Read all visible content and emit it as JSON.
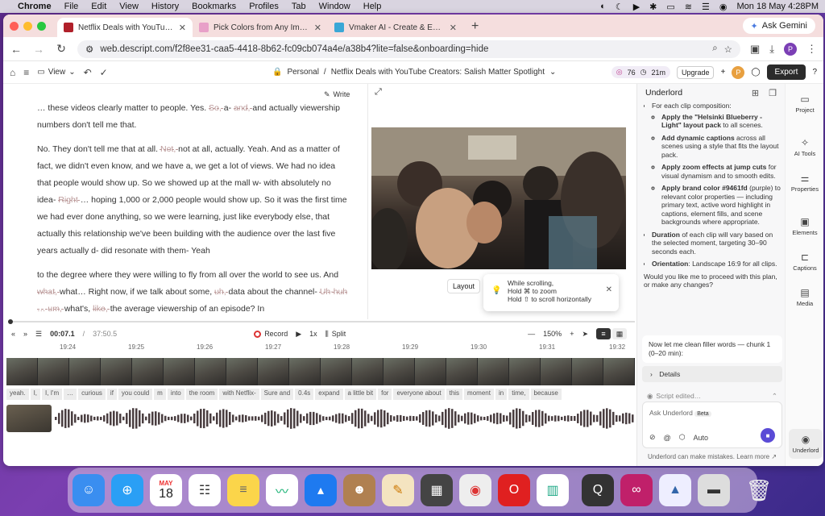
{
  "menubar": {
    "app": "Chrome",
    "items": [
      "File",
      "Edit",
      "View",
      "History",
      "Bookmarks",
      "Profiles",
      "Tab",
      "Window",
      "Help"
    ],
    "clock": "Mon 18 May  4:28PM"
  },
  "tabs": [
    {
      "label": "Netflix Deals with YouTube Cr…",
      "color": "#b0202a"
    },
    {
      "label": "Pick Colors from Any Image -…",
      "color": "#e8a0c8"
    },
    {
      "label": "Vmaker AI - Create & Edit Vid…",
      "color": "#3aa7d6"
    }
  ],
  "ask_gemini": "Ask Gemini",
  "omnibox": {
    "url": "web.descript.com/f2f8ee31-caa5-4418-8b62-fc09cb074a4e/a38b4?lite=false&onboarding=hide"
  },
  "profile_initial": "P",
  "appbar": {
    "view_label": "View",
    "breadcrumb_workspace": "Personal",
    "breadcrumb_sep": "/",
    "project_title": "Netflix Deals with YouTube Creators: Salish Matter Spotlight",
    "credits": "76",
    "minutes": "21m",
    "upgrade": "Upgrade",
    "export": "Export"
  },
  "script": {
    "write_label": "Write",
    "p1": {
      "pre": "… these videos clearly matter to people. Yes. ",
      "s1": "So, ",
      "mid": "a- ",
      "s2": "and, ",
      "post": "and actually viewership numbers don't tell me that."
    },
    "p2": {
      "a": "No. They don't tell me that at all. ",
      "s1": "Not, ",
      "b": "not at all, actually. Yeah. And as a matter of fact, we didn't even know, and we have a, we get a lot of views. We had no idea that people would show up. So we showed up at the mall w- with absolutely no idea- ",
      "s2": "Right ",
      "c": "… hoping 1,000 or 2,000 people would show up. So it was the first time we had ever done anything, so we were learning, just like everybody else, that actually this relationship we've been building with the audience over the last five years actually d- did resonate with them- Yeah"
    },
    "p3": {
      "a": "to the degree where they were willing to fly from all over the world to see us. And ",
      "s1": "what, ",
      "b": "what… Right now, if we talk about some, ",
      "s2": "uh, ",
      "c": "data about the channel- ",
      "s3": "Uh-huh … um, ",
      "d": "what's, ",
      "s4": "like, ",
      "e": "the average viewership of an episode? In"
    }
  },
  "video": {
    "layout_label": "Layout",
    "tooltip_line1": "While scrolling,",
    "tooltip_line2": "Hold ⌘ to zoom",
    "tooltip_line3": "Hold ⇧ to scroll horizontally"
  },
  "transport": {
    "current": "00:07.1",
    "separator": "/",
    "total": "37:50.5",
    "record": "Record",
    "speed": "1x",
    "split": "Split",
    "zoom": "150%"
  },
  "ruler": [
    "19:24",
    "19:25",
    "19:26",
    "19:27",
    "19:28",
    "19:29",
    "19:30",
    "19:31",
    "19:32"
  ],
  "word_chips": [
    "yeah.",
    "I,",
    "I, I'm",
    "…",
    "curious",
    "if",
    "you could",
    "m",
    "into",
    "the room",
    "with Netflix-",
    "Sure and",
    "0.4s",
    "expand",
    "a little bit",
    "for",
    "everyone about",
    "this",
    "moment",
    "in",
    "time,",
    "because"
  ],
  "underlord": {
    "title": "Underlord",
    "intro": "For each clip composition:",
    "bullets": [
      {
        "bold": "Apply the \"Helsinki Blueberry - Light\" layout pack",
        "rest": " to all scenes."
      },
      {
        "bold": "Add dynamic captions",
        "rest": " across all scenes using a style that fits the layout pack."
      },
      {
        "bold": "Apply zoom effects at jump cuts",
        "rest": " for visual dynamism and to smooth edits."
      },
      {
        "bold": "Apply brand color #9461fd",
        "rest": " (purple) to relevant color properties — including primary text, active word highlight in captions, element fills, and scene backgrounds where appropriate."
      }
    ],
    "duration": {
      "bold": "Duration",
      "rest": " of each clip will vary based on the selected moment, targeting 30–90 seconds each."
    },
    "orientation": {
      "bold": "Orientation",
      "rest": ": Landscape 16:9 for all clips."
    },
    "question": "Would you like me to proceed with this plan, or make any changes?",
    "message": "Now let me clean filler words — chunk 1 (0–20 min):",
    "details": "Details",
    "script_edited": "Script edited…",
    "ask_placeholder": "Ask Underlord",
    "beta": "Beta",
    "auto": "Auto",
    "footer": "Underlord can make mistakes. Learn more ↗"
  },
  "rail": [
    "Project",
    "AI Tools",
    "Properties",
    "Elements",
    "Captions",
    "Media",
    "Underlord"
  ],
  "dock": {
    "calendar_month": "MAY",
    "calendar_day": "18"
  },
  "colors": {
    "accent": "#5a4bd6",
    "brand": "#9461fd",
    "strike": "#b99"
  }
}
